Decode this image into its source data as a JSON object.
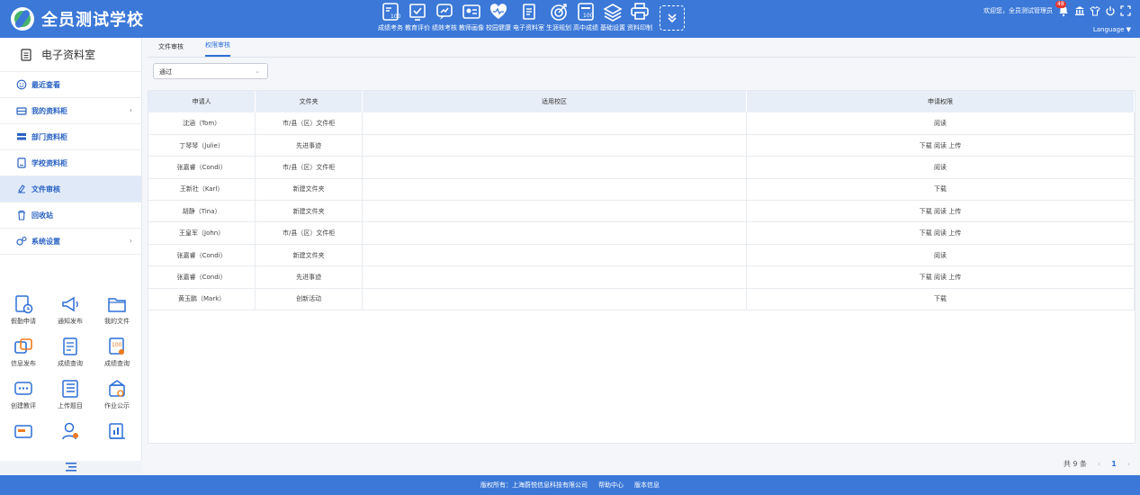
{
  "header": {
    "title": "全员测试学校",
    "nav": [
      {
        "label": "成绩考务",
        "icon": "score-100-icon"
      },
      {
        "label": "教育评价",
        "icon": "check-board-icon"
      },
      {
        "label": "绩效考核",
        "icon": "chart-chat-icon"
      },
      {
        "label": "教师画像",
        "icon": "teacher-card-icon"
      },
      {
        "label": "校园健康",
        "icon": "heart-pulse-icon"
      },
      {
        "label": "电子资料室",
        "icon": "document-icon"
      },
      {
        "label": "生涯规划",
        "icon": "target-icon"
      },
      {
        "label": "高中成绩",
        "icon": "score-card-icon"
      },
      {
        "label": "基础设置",
        "icon": "layers-icon"
      },
      {
        "label": "资料印制",
        "icon": "printer-icon"
      }
    ],
    "welcome": "欢迎您，全员测试管理员",
    "notification_count": "48",
    "language": "Language"
  },
  "sidebar": {
    "title": "电子资料室",
    "items": [
      {
        "label": "最近查看",
        "icon": "smile-icon",
        "chevron": false,
        "active": false
      },
      {
        "label": "我的资料柜",
        "icon": "cabinet-icon",
        "chevron": true,
        "active": false
      },
      {
        "label": "部门资料柜",
        "icon": "server-icon",
        "chevron": false,
        "active": false
      },
      {
        "label": "学校资料柜",
        "icon": "file-box-icon",
        "chevron": false,
        "active": false
      },
      {
        "label": "文件审核",
        "icon": "audit-icon",
        "chevron": false,
        "active": true
      },
      {
        "label": "回收站",
        "icon": "trash-icon",
        "chevron": false,
        "active": false
      },
      {
        "label": "系统设置",
        "icon": "settings-icon",
        "chevron": true,
        "active": false
      }
    ],
    "apps": [
      {
        "label": "假勤申请",
        "icon": "leave-request-icon"
      },
      {
        "label": "通知发布",
        "icon": "megaphone-icon"
      },
      {
        "label": "我的文件",
        "icon": "folder-icon"
      },
      {
        "label": "信息发布",
        "icon": "info-publish-icon"
      },
      {
        "label": "成绩查询",
        "icon": "score-sheet-icon"
      },
      {
        "label": "成绩查询",
        "icon": "score-100-search-icon"
      },
      {
        "label": "创建教评",
        "icon": "chat-bubble-icon"
      },
      {
        "label": "上传题目",
        "icon": "list-upload-icon"
      },
      {
        "label": "作业公示",
        "icon": "homework-icon"
      },
      {
        "label": "",
        "icon": "card-icon"
      },
      {
        "label": "",
        "icon": "user-icon"
      },
      {
        "label": "",
        "icon": "chart-book-icon"
      }
    ]
  },
  "tabs": [
    {
      "label": "文件审核",
      "active": false
    },
    {
      "label": "权限审核",
      "active": true
    }
  ],
  "filter": {
    "value": "通过"
  },
  "table": {
    "headers": [
      "申请人",
      "文件夹",
      "适用校区",
      "申请权限"
    ],
    "rows": [
      [
        "沈涵（Tom）",
        "市/县（区）文件柜",
        "",
        "阅读"
      ],
      [
        "丁琴琴（Julie）",
        "先进事迹",
        "",
        "下载 阅读 上传"
      ],
      [
        "张嘉睿（Condi）",
        "市/县（区）文件柜",
        "",
        "阅读"
      ],
      [
        "王新社（Karl）",
        "新建文件夹",
        "",
        "下载"
      ],
      [
        "胡静（Tina）",
        "新建文件夹",
        "",
        "下载 阅读 上传"
      ],
      [
        "王皇军（John）",
        "市/县（区）文件柜",
        "",
        "下载 阅读 上传"
      ],
      [
        "张嘉睿（Condi）",
        "新建文件夹",
        "",
        "阅读"
      ],
      [
        "张嘉睿（Condi）",
        "先进事迹",
        "",
        "下载 阅读 上传"
      ],
      [
        "黄玉鹏（Mark）",
        "创新活动",
        "",
        "下载"
      ]
    ]
  },
  "pager": {
    "total": "共 9 条",
    "prev": "‹",
    "current": "1",
    "next": "›"
  },
  "footer": {
    "copyright": "版权所有：上海蔚悦信息科技有限公司",
    "help": "帮助中心",
    "version": "版本信息"
  },
  "colors": {
    "brand": "#3b78d8",
    "accent": "#2d6ed6",
    "active_row": "#dfe9f8"
  }
}
